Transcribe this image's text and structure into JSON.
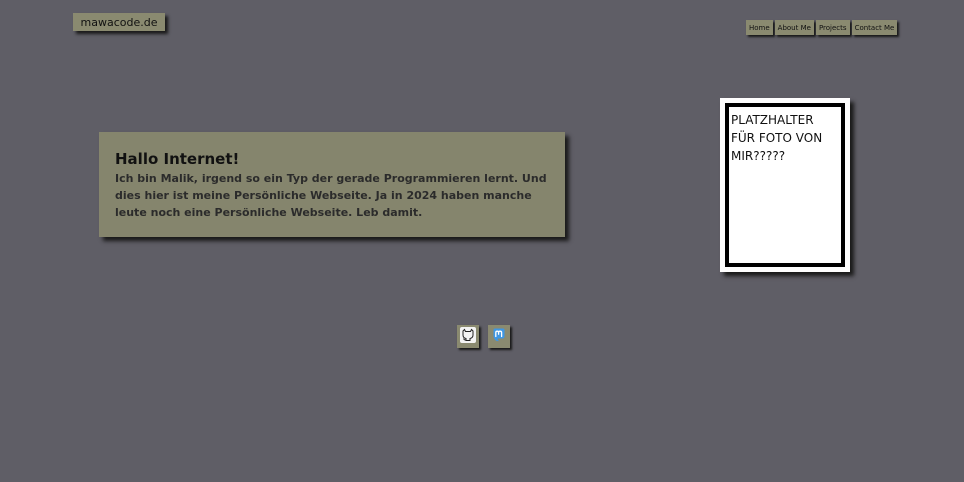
{
  "brand": {
    "logo_text": "mawacode.de"
  },
  "nav": {
    "items": [
      {
        "label": "Home"
      },
      {
        "label": "About Me"
      },
      {
        "label": "Projects"
      },
      {
        "label": "Contact Me"
      }
    ]
  },
  "intro": {
    "heading": "Hallo Internet!",
    "text": "Ich bin Malik, irgend so ein Typ der gerade Programmieren lernt. Und dies hier ist meine Persönliche Webseite. Ja in 2024 haben manche leute noch eine Persönliche Webseite. Leb damit."
  },
  "photo": {
    "placeholder_text": "PLATZHALTER FÜR FOTO VON MIR?????"
  },
  "social": {
    "icons": [
      {
        "name": "github-icon"
      },
      {
        "name": "mastodon-icon"
      }
    ]
  },
  "colors": {
    "background": "#5f5e66",
    "panel": "#85856d",
    "button": "#8a8a70"
  }
}
